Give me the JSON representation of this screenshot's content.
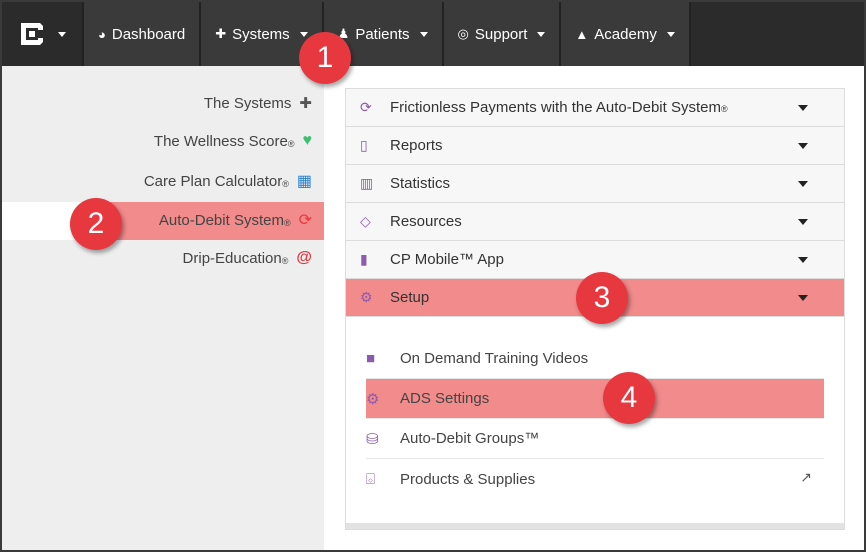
{
  "nav": {
    "items": [
      {
        "label": "Dashboard",
        "icon": "dashboard-icon",
        "caret": false
      },
      {
        "label": "Systems",
        "icon": "puzzle-icon",
        "caret": true
      },
      {
        "label": "Patients",
        "icon": "users-icon",
        "caret": true
      },
      {
        "label": "Support",
        "icon": "lifebuoy-icon",
        "caret": true
      },
      {
        "label": "Academy",
        "icon": "graduation-cap-icon",
        "caret": true
      }
    ]
  },
  "sidebar": {
    "items": [
      {
        "label": "The Systems",
        "reg": "",
        "icon": "puzzle-icon",
        "icon_color": "#555555"
      },
      {
        "label": "The Wellness Score",
        "reg": "®",
        "icon": "heartbeat-icon",
        "icon_color": "#3cbf6e"
      },
      {
        "label": "Care Plan Calculator",
        "reg": "®",
        "icon": "calculator-icon",
        "icon_color": "#2a7fd4"
      },
      {
        "label": "Auto-Debit System",
        "reg": "®",
        "icon": "refresh-icon",
        "icon_color": "#e8383f",
        "active": true
      },
      {
        "label": "Drip-Education",
        "reg": "®",
        "icon": "at-icon",
        "icon_color": "#e8383f"
      }
    ]
  },
  "accordion": {
    "rows": [
      {
        "label": "Frictionless Payments with the Auto-Debit System",
        "reg": "®",
        "icon": "refresh-icon"
      },
      {
        "label": "Reports",
        "reg": "",
        "icon": "file-icon"
      },
      {
        "label": "Statistics",
        "reg": "",
        "icon": "bar-chart-icon"
      },
      {
        "label": "Resources",
        "reg": "",
        "icon": "diamond-icon"
      },
      {
        "label": "CP Mobile™ App",
        "reg": "",
        "icon": "mobile-icon"
      },
      {
        "label": "Setup",
        "reg": "",
        "icon": "cogs-icon",
        "highlighted": true
      }
    ],
    "setup_items": [
      {
        "label": "On Demand Training Videos",
        "icon": "video-icon"
      },
      {
        "label": "ADS Settings",
        "icon": "gear-icon",
        "highlighted": true
      },
      {
        "label": "Auto-Debit Groups™",
        "icon": "database-icon"
      },
      {
        "label": "Products & Supplies",
        "icon": "basket-icon",
        "external": true
      }
    ]
  },
  "callouts": [
    "1",
    "2",
    "3",
    "4"
  ],
  "colors": {
    "accent_purple": "#8c5bb0",
    "highlight": "#f28b8b",
    "badge_red": "#e8383f",
    "nav_bg": "#3a3a3a"
  }
}
